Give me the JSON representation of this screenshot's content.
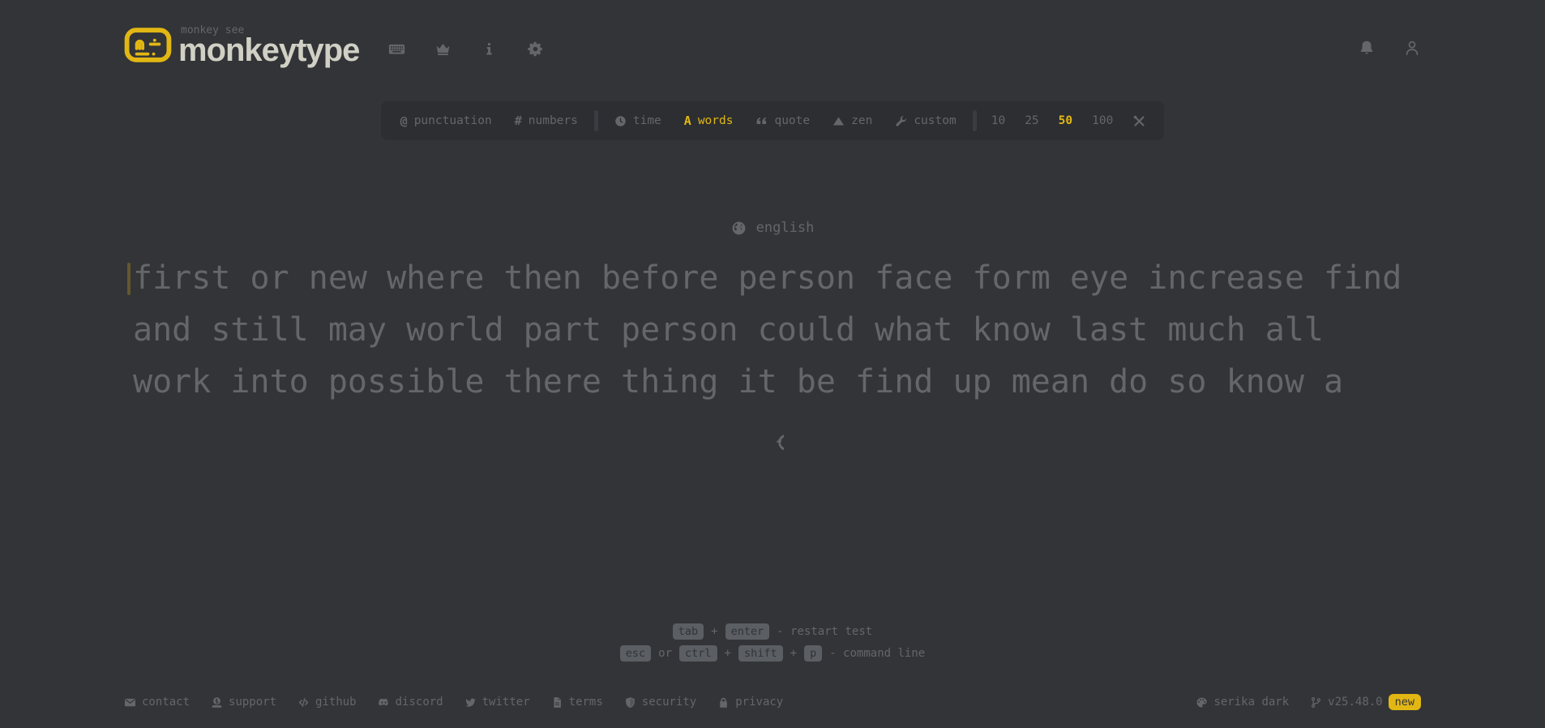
{
  "colors": {
    "background": "#323437",
    "accent": "#e2b714",
    "sub": "#646669",
    "text": "#d1d0c5",
    "bar_background": "#2c2e31"
  },
  "header": {
    "logo_small": "monkey see",
    "logo_title": "monkeytype",
    "nav_icons": [
      "keyboard-icon",
      "crown-icon",
      "info-icon",
      "settings-gear-icon"
    ],
    "right_icons": [
      "notification-bell-icon",
      "user-icon"
    ]
  },
  "config": {
    "punctuation": "punctuation",
    "numbers": "numbers",
    "time": "time",
    "words": "words",
    "quote": "quote",
    "zen": "zen",
    "custom": "custom",
    "counts": [
      "10",
      "25",
      "50",
      "100"
    ],
    "active_mode": "words",
    "active_count": "50"
  },
  "test": {
    "language": "english",
    "lines": [
      "first or new where then before person face form eye increase find",
      "and still may world part person could what know last much all",
      "work into possible there thing it be find up mean do so know a"
    ]
  },
  "hints": {
    "restart": {
      "key1": "tab",
      "plus": "+",
      "key2": "enter",
      "text": "- restart test"
    },
    "command": {
      "key1": "esc",
      "or": "or",
      "key2": "ctrl",
      "plus1": "+",
      "key3": "shift",
      "plus2": "+",
      "key4": "p",
      "text": "- command line"
    }
  },
  "footer": {
    "links": [
      {
        "label": "contact"
      },
      {
        "label": "support"
      },
      {
        "label": "github"
      },
      {
        "label": "discord"
      },
      {
        "label": "twitter"
      },
      {
        "label": "terms"
      },
      {
        "label": "security"
      },
      {
        "label": "privacy"
      }
    ],
    "theme": "serika dark",
    "version": "v25.48.0",
    "badge": "new"
  }
}
